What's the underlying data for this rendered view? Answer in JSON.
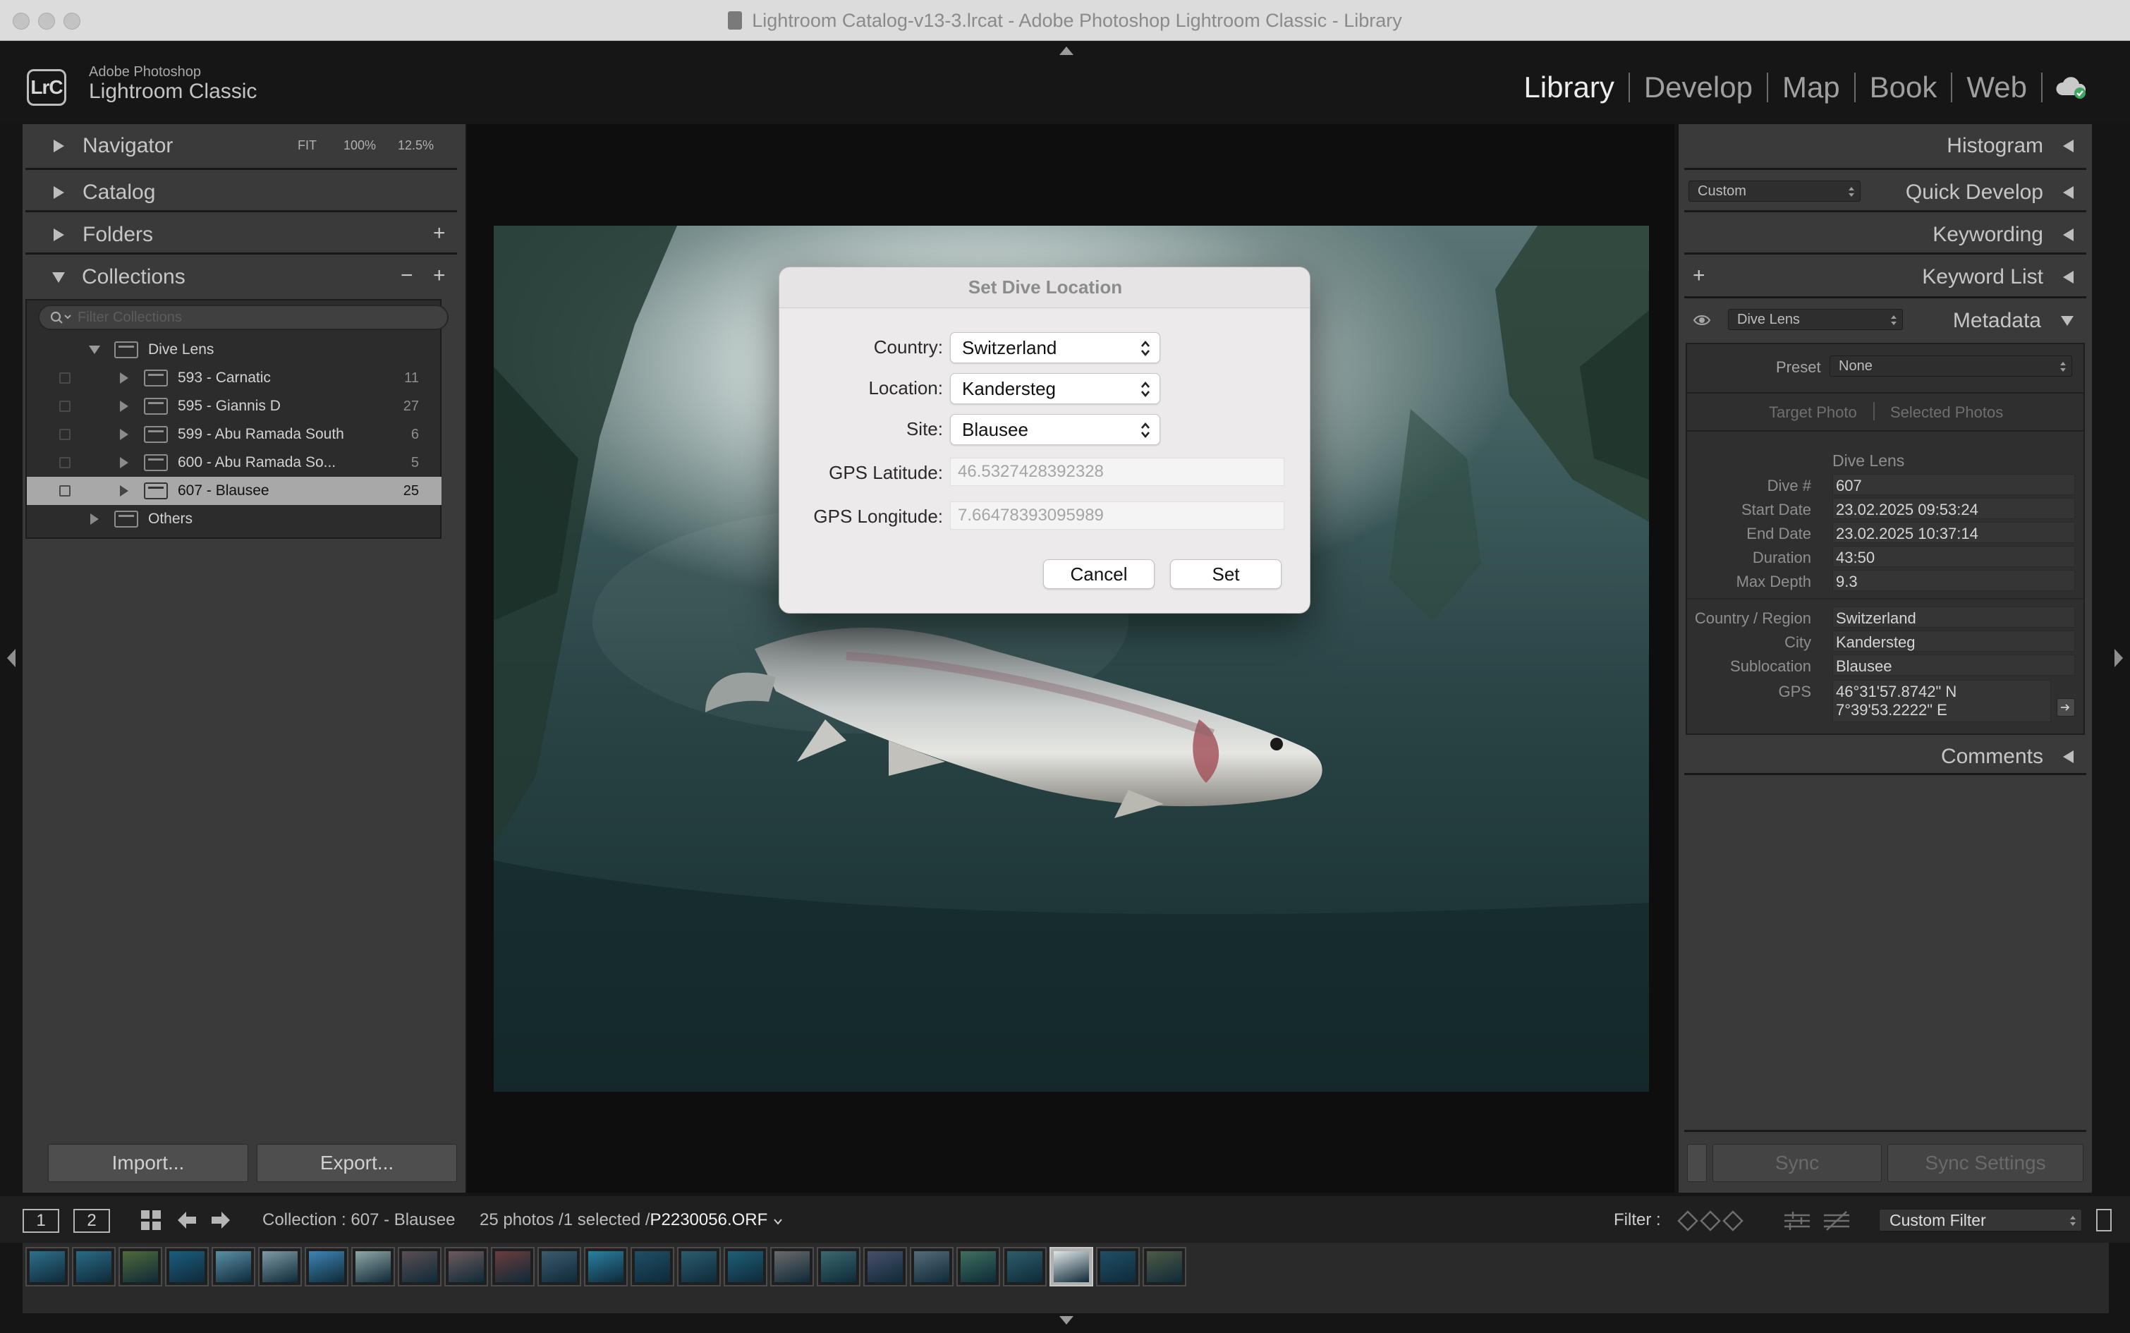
{
  "window": {
    "title": "Lightroom Catalog-v13-3.lrcat - Adobe Photoshop Lightroom Classic - Library"
  },
  "identity": {
    "badge": "LrC",
    "line1": "Adobe Photoshop",
    "line2": "Lightroom Classic"
  },
  "modules": [
    "Library",
    "Develop",
    "Map",
    "Book",
    "Web"
  ],
  "active_module": "Library",
  "left_panel": {
    "navigator": {
      "label": "Navigator",
      "zoom_options": [
        "FIT",
        "100%",
        "12.5%"
      ]
    },
    "catalog": {
      "label": "Catalog"
    },
    "folders": {
      "label": "Folders",
      "add": "+"
    },
    "collections": {
      "label": "Collections",
      "minus": "−",
      "plus": "+",
      "filter_placeholder": "Filter Collections",
      "set_name": "Dive Lens",
      "items": [
        {
          "name": "593 - Carnatic",
          "count": "11"
        },
        {
          "name": "595 - Giannis D",
          "count": "27"
        },
        {
          "name": "599 - Abu Ramada South",
          "count": "6"
        },
        {
          "name": "600 - Abu Ramada So...",
          "count": "5"
        },
        {
          "name": "607 - Blausee",
          "count": "25"
        }
      ],
      "selected_index": 4,
      "others": "Others"
    },
    "import_label": "Import...",
    "export_label": "Export..."
  },
  "dialog": {
    "title": "Set Dive Location",
    "country_label": "Country:",
    "country_value": "Switzerland",
    "location_label": "Location:",
    "location_value": "Kandersteg",
    "site_label": "Site:",
    "site_value": "Blausee",
    "lat_label": "GPS Latitude:",
    "lat_value": "46.5327428392328",
    "lon_label": "GPS Longitude:",
    "lon_value": "7.66478393095989",
    "cancel_label": "Cancel",
    "set_label": "Set"
  },
  "right_panel": {
    "histogram": "Histogram",
    "quick_develop": {
      "label": "Quick Develop",
      "preset": "Custom"
    },
    "keywording": "Keywording",
    "keyword_list": {
      "label": "Keyword List",
      "add": "+"
    },
    "metadata": {
      "label": "Metadata",
      "set": "Dive Lens",
      "preset_label": "Preset",
      "preset_value": "None",
      "tab_target": "Target Photo",
      "tab_selected": "Selected Photos",
      "section": "Dive Lens",
      "rows_a": [
        {
          "label": "Dive #",
          "value": "607"
        },
        {
          "label": "Start Date",
          "value": "23.02.2025 09:53:24"
        },
        {
          "label": "End Date",
          "value": "23.02.2025 10:37:14"
        },
        {
          "label": "Duration",
          "value": "43:50"
        },
        {
          "label": "Max Depth",
          "value": "9.3"
        }
      ],
      "rows_b": [
        {
          "label": "Country / Region",
          "value": "Switzerland"
        },
        {
          "label": "City",
          "value": "Kandersteg"
        },
        {
          "label": "Sublocation",
          "value": "Blausee"
        }
      ],
      "gps_label": "GPS",
      "gps_line1": "46°31'57.8742\" N",
      "gps_line2": "7°39'53.2222\" E"
    },
    "comments": "Comments",
    "sync_label": "Sync",
    "sync_settings_label": "Sync Settings"
  },
  "toolbar": {
    "view1": "1",
    "view2": "2",
    "source": "Collection : 607 - Blausee",
    "count_text": "25 photos /1 selected /",
    "filename": "P2230056.ORF",
    "filter_label": "Filter :",
    "filter_value": "Custom Filter"
  },
  "filmstrip": {
    "selected_index": 22,
    "thumb_colors": [
      "#2f6f8c",
      "#2a6a86",
      "#4f6a3a",
      "#1c5d7f",
      "#5a8fa6",
      "#7e9aa4",
      "#3f84b5",
      "#8fa7a4",
      "#5a4f52",
      "#6e5a5c",
      "#6b3c3c",
      "#3d5a6e",
      "#2b7fa2",
      "#1f4f66",
      "#2a5d6e",
      "#1f5f78",
      "#6a6a6a",
      "#3b6870",
      "#48506a",
      "#556b7a",
      "#3f6f5e",
      "#2e5d6a",
      "#e0e6e6",
      "#1f4f66",
      "#4f5a45"
    ]
  }
}
